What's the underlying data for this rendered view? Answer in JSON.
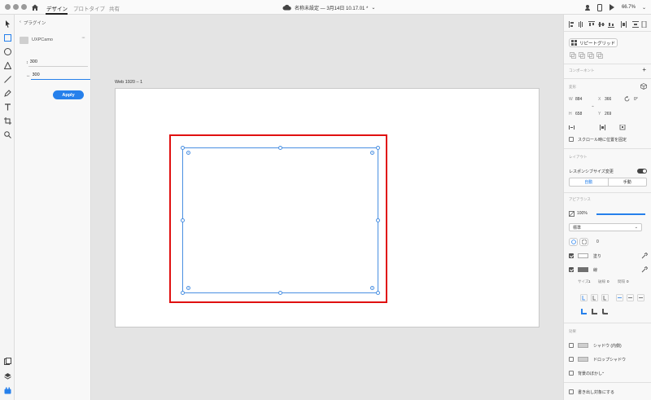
{
  "titlebar": {
    "tabs": [
      "デザイン",
      "プロトタイプ",
      "共有"
    ],
    "active_tab": "デザイン",
    "document_title": "名称未設定 — 3月14日 10.17.01 *",
    "zoom": "66.7%"
  },
  "plugin_panel": {
    "back_label": "プラグイン",
    "plugin_name": "UXPCamo",
    "width_label": "↕",
    "width_value": "300",
    "height_label": "↔",
    "height_value": "300",
    "apply_label": "Apply"
  },
  "canvas": {
    "artboard_name": "Web 1920 – 1"
  },
  "right_panel": {
    "repeat_grid_label": "リピートグリッド",
    "component_section": "コンポーネント",
    "transform_section": "変形",
    "w_label": "W",
    "w_value": "884",
    "x_label": "X",
    "x_value": "366",
    "rotation_value": "0°",
    "h_label": "H",
    "h_value": "658",
    "y_label": "Y",
    "y_value": "269",
    "scroll_fix_label": "スクロール時に位置を固定",
    "layout_section": "レイアウト",
    "responsive_label": "レスポンシブサイズ変更",
    "auto_label": "自動",
    "manual_label": "手動",
    "appearance_section": "アピアランス",
    "opacity_value": "100%",
    "blend_mode": "標準",
    "corner_value": "0",
    "fill_label": "塗り",
    "border_label": "線",
    "size_label": "サイズ",
    "size_value": "1",
    "dash_label": "破線",
    "dash_value": "0",
    "gap_label": "間隔",
    "gap_value": "0",
    "effects_section": "効果",
    "shadow_label": "シャドウ (内側)",
    "drop_shadow_label": "ドロップシャドウ",
    "bg_blur_label": "背景のぼかし",
    "export_label": "書き出し対象にする"
  },
  "colors": {
    "accent": "#2680eb",
    "highlight_frame": "#e01010",
    "selection": "#4a90e2"
  }
}
